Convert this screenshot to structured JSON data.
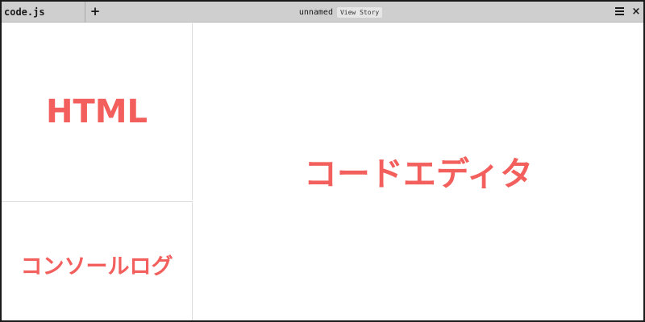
{
  "header": {
    "tab_label": "code.js",
    "add_label": "+",
    "doc_name": "unnamed",
    "view_story_label": "View Story",
    "close_label": "×"
  },
  "panes": {
    "html_label": "HTML",
    "console_label": "コンソールログ",
    "editor_label": "コードエディタ"
  },
  "icons": {
    "add": "plus-icon",
    "menu": "hamburger-menu-icon",
    "close": "close-icon"
  },
  "colors": {
    "accent": "#f25f5c",
    "toolbar": "#cfcfcf",
    "frame": "#1a1a1a"
  }
}
